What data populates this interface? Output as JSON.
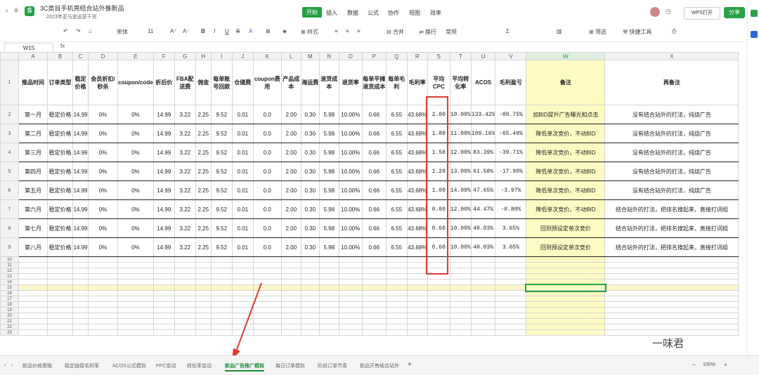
{
  "titlebar": {
    "doc_title": "3C类目手机壳结合站外推新品",
    "subtitle": "2023年亚马逊运营干货",
    "menus": [
      "开始",
      "插入",
      "数据",
      "公式",
      "协作",
      "视图",
      "效率"
    ],
    "wps_open": "WPS打开",
    "share": "分享"
  },
  "toolbar": {
    "font_name": "宋体",
    "font_size": "11",
    "style": "样式",
    "merge": "合并",
    "wrap": "换行",
    "format": "常规",
    "filter": "筛选",
    "quick": "快捷工具"
  },
  "formula_bar": {
    "cell_ref": "W15",
    "fx": "fx"
  },
  "columns": [
    "A",
    "B",
    "C",
    "D",
    "E",
    "F",
    "G",
    "H",
    "I",
    "J",
    "K",
    "L",
    "M",
    "N",
    "O",
    "P",
    "Q",
    "R",
    "S",
    "T",
    "U",
    "V",
    "W",
    "X"
  ],
  "headers": [
    "推品时间",
    "订单类型",
    "稳定价格",
    "会员折扣/秒杀",
    "coupon/code",
    "折后价",
    "FBA配送费",
    "佣金",
    "每单账号回款",
    "仓储费",
    "coupon费用",
    "产品成本",
    "海运费",
    "退货成本",
    "退货率",
    "每单平摊退货成本",
    "每单毛利",
    "毛利率",
    "平均CPC",
    "平均转化率",
    "ACOS",
    "毛利盈亏",
    "备注",
    "再备注"
  ],
  "rows": [
    [
      "第一月",
      "稳定价格",
      "14.99",
      "0%",
      "0%",
      "14.99",
      "3.22",
      "2.25",
      "9.52",
      "0.01",
      "0.0",
      "2.00",
      "0.30",
      "5.98",
      "10.00%",
      "0.66",
      "6.55",
      "43.68%",
      "2.00",
      "10.00%",
      "133.42%",
      "-89.75%",
      "加BID提升广告曝光和点击",
      "没有结合站外的打法，纯烧广告"
    ],
    [
      "第二月",
      "稳定价格",
      "14.99",
      "0%",
      "0%",
      "14.99",
      "3.22",
      "2.25",
      "9.52",
      "0.01",
      "0.0",
      "2.00",
      "0.30",
      "5.98",
      "10.00%",
      "0.66",
      "6.55",
      "43.68%",
      "1.80",
      "11.00%",
      "109.16%",
      "-65.49%",
      "降低单次竞价，不动BID",
      "没有结合站外的打法，纯烧广告"
    ],
    [
      "第三月",
      "稳定价格",
      "14.99",
      "0%",
      "0%",
      "14.99",
      "3.22",
      "2.25",
      "9.52",
      "0.01",
      "0.0",
      "2.00",
      "0.30",
      "5.98",
      "10.00%",
      "0.66",
      "6.55",
      "43.68%",
      "1.50",
      "12.00%",
      "83.39%",
      "-39.71%",
      "降低单次竞价，不动BID",
      "没有结合站外的打法，纯烧广告"
    ],
    [
      "第四月",
      "稳定价格",
      "14.99",
      "0%",
      "0%",
      "14.99",
      "3.22",
      "2.25",
      "9.52",
      "0.01",
      "0.0",
      "2.00",
      "0.30",
      "5.98",
      "10.00%",
      "0.66",
      "6.55",
      "43.68%",
      "1.20",
      "13.00%",
      "61.58%",
      "-17.90%",
      "降低单次竞价，不动BID",
      "没有结合站外的打法，纯烧广告"
    ],
    [
      "第五月",
      "稳定价格",
      "14.99",
      "0%",
      "0%",
      "14.99",
      "3.22",
      "2.25",
      "9.52",
      "0.01",
      "0.0",
      "2.00",
      "0.30",
      "5.98",
      "10.00%",
      "0.66",
      "6.55",
      "43.68%",
      "1.00",
      "14.00%",
      "47.65%",
      "-3.97%",
      "降低单次竞价，不动BID",
      "没有结合站外的打法，纯烧广告"
    ],
    [
      "第六月",
      "稳定价格",
      "14.99",
      "0%",
      "0%",
      "14.99",
      "3.22",
      "2.25",
      "9.52",
      "0.01",
      "0.0",
      "2.00",
      "0.30",
      "5.98",
      "10.00%",
      "0.66",
      "6.55",
      "43.68%",
      "0.80",
      "12.00%",
      "44.47%",
      "-0.80%",
      "降低单次竞价，不动BID",
      "结合站外的打法，把排名搜起来，直接打词组"
    ],
    [
      "第七月",
      "稳定价格",
      "14.99",
      "0%",
      "0%",
      "14.99",
      "3.22",
      "2.25",
      "9.52",
      "0.01",
      "0.0",
      "2.00",
      "0.30",
      "5.98",
      "10.00%",
      "0.66",
      "6.55",
      "43.68%",
      "0.60",
      "10.00%",
      "40.03%",
      "3.65%",
      "回到预设定单次竞价",
      "结合站外的打法，把排名搜起来，直接打词组"
    ],
    [
      "第八月",
      "稳定价格",
      "14.99",
      "0%",
      "0%",
      "14.99",
      "3.22",
      "2.25",
      "9.52",
      "0.01",
      "0.0",
      "2.00",
      "0.30",
      "5.98",
      "10.00%",
      "0.66",
      "6.55",
      "43.68%",
      "0.60",
      "10.00%",
      "40.03%",
      "3.65%",
      "回到预设定单次竞价",
      "结合站外的打法，把排名搜起来，直接打词组"
    ]
  ],
  "empty_rows": [
    "10",
    "11",
    "12",
    "13",
    "14",
    "15",
    "16",
    "17",
    "18",
    "19",
    "20",
    "21",
    "22",
    "23"
  ],
  "sheet_tabs": [
    "新品价格策略",
    "稳定链接毛利率",
    "ACOS公式模拟",
    "PPC变动",
    "转化率变动",
    "新品广告推广模拟",
    "每日订单模拟",
    "阶段订单节奏",
    "新品开售结合站外"
  ],
  "active_tab": 5,
  "zoom": "100%",
  "watermark": "一味君",
  "colors": {
    "accent": "#27a245",
    "highlight": "#fdfbc3",
    "red_box": "#e03a32"
  }
}
